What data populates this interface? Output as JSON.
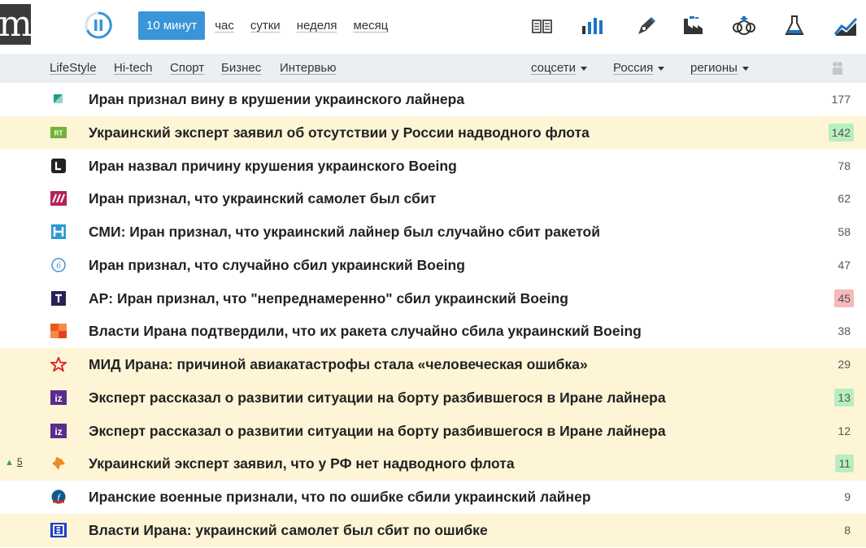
{
  "logo": "m",
  "periods": [
    {
      "label": "10 минут",
      "active": true
    },
    {
      "label": "час"
    },
    {
      "label": "сутки"
    },
    {
      "label": "неделя"
    },
    {
      "label": "месяц"
    }
  ],
  "tools": [
    "columns-icon",
    "bar-chart-icon",
    "pen-icon",
    "factory-icon",
    "sports-icon",
    "flask-icon",
    "trend-icon"
  ],
  "categories": [
    "LifeStyle",
    "Hi-tech",
    "Спорт",
    "Бизнес",
    "Интервью"
  ],
  "dropdowns": [
    "соцсети",
    "Россия",
    "регионы"
  ],
  "news": [
    {
      "title": "Иран признал вину в крушении украинского лайнера",
      "count": "177",
      "highlight": false,
      "count_style": "",
      "source_icon": "triangle-logo"
    },
    {
      "title": "Украинский эксперт заявил об отсутствии у России надводного флота",
      "count": "142",
      "highlight": true,
      "count_style": "green",
      "source_icon": "rt-logo"
    },
    {
      "title": "Иран назвал причину крушения украинского Boeing",
      "count": "78",
      "highlight": false,
      "count_style": "",
      "source_icon": "l-logo"
    },
    {
      "title": "Иран признал, что украинский самолет был сбит",
      "count": "62",
      "highlight": false,
      "count_style": "",
      "source_icon": "slash-logo"
    },
    {
      "title": "СМИ: Иран признал, что украинский лайнер был случайно сбит ракетой",
      "count": "58",
      "highlight": false,
      "count_style": "",
      "source_icon": "h-logo"
    },
    {
      "title": "Иран признал, что случайно сбил украинский Boeing",
      "count": "47",
      "highlight": false,
      "count_style": "",
      "source_icon": "circle-b-logo"
    },
    {
      "title": "AP: Иран признал, что \"непреднамеренно\" сбил украинский Boeing",
      "count": "45",
      "highlight": false,
      "count_style": "red",
      "source_icon": "t-logo"
    },
    {
      "title": "Власти Ирана подтвердили, что их ракета случайно сбила украинский Boeing",
      "count": "38",
      "highlight": false,
      "count_style": "",
      "source_icon": "squares-logo"
    },
    {
      "title": "МИД Ирана: причиной авиакатастрофы стала «человеческая ошибка»",
      "count": "29",
      "highlight": true,
      "count_style": "",
      "source_icon": "star-logo"
    },
    {
      "title": "Эксперт рассказал о развитии ситуации на борту разбившегося в Иране лайнера",
      "count": "13",
      "highlight": true,
      "count_style": "green",
      "source_icon": "iz-logo"
    },
    {
      "title": "Эксперт рассказал о развитии ситуации на борту разбившегося в Иране лайнера",
      "count": "12",
      "highlight": true,
      "count_style": "",
      "source_icon": "iz-logo"
    },
    {
      "title": "Украинский эксперт заявил, что у РФ нет надводного флота",
      "count": "11",
      "highlight": true,
      "count_style": "green",
      "source_icon": "orange-logo",
      "rank": "5"
    },
    {
      "title": "Иранские военные признали, что по ошибке сбили украинский лайнер",
      "count": "9",
      "highlight": false,
      "count_style": "",
      "source_icon": "f-logo"
    },
    {
      "title": "Власти Ирана: украинский самолет был сбит по ошибке",
      "count": "8",
      "highlight": true,
      "count_style": "",
      "source_icon": "b-logo"
    }
  ]
}
